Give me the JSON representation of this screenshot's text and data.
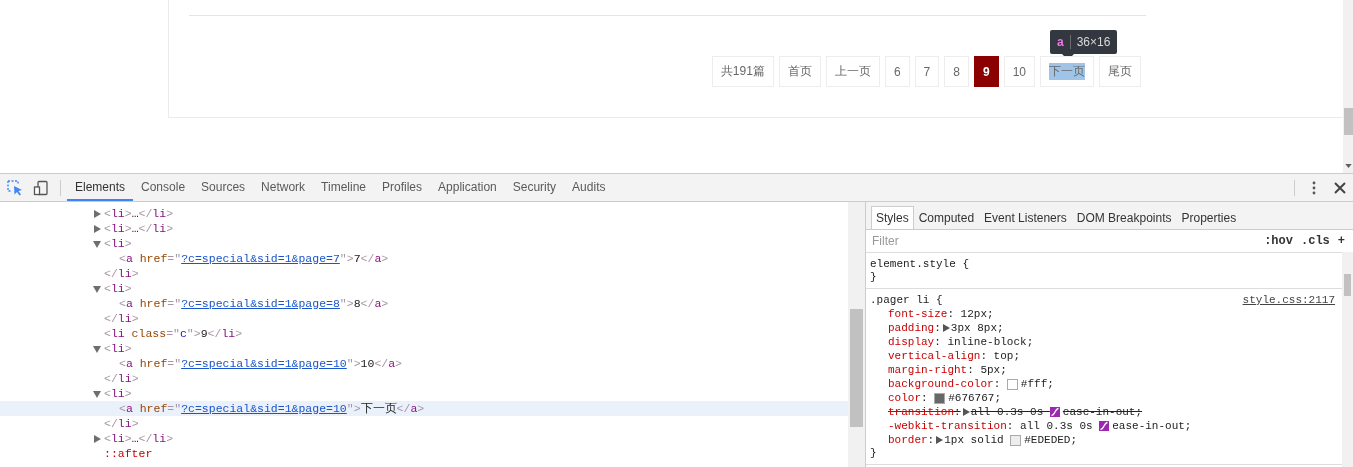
{
  "pager": {
    "items": [
      {
        "label": "共191篇",
        "selected": false,
        "inspected": false
      },
      {
        "label": "首页",
        "selected": false,
        "inspected": false
      },
      {
        "label": "上一页",
        "selected": false,
        "inspected": false
      },
      {
        "label": "6",
        "selected": false,
        "inspected": false
      },
      {
        "label": "7",
        "selected": false,
        "inspected": false
      },
      {
        "label": "8",
        "selected": false,
        "inspected": false
      },
      {
        "label": "9",
        "selected": true,
        "inspected": false
      },
      {
        "label": "10",
        "selected": false,
        "inspected": false
      },
      {
        "label": "下一页",
        "selected": false,
        "inspected": true
      },
      {
        "label": "尾页",
        "selected": false,
        "inspected": false
      }
    ],
    "tooltip": {
      "tag": "a",
      "size": "36×16"
    }
  },
  "devtools": {
    "tabs": [
      {
        "label": "Elements",
        "selected": true
      },
      {
        "label": "Console",
        "selected": false
      },
      {
        "label": "Sources",
        "selected": false
      },
      {
        "label": "Network",
        "selected": false
      },
      {
        "label": "Timeline",
        "selected": false
      },
      {
        "label": "Profiles",
        "selected": false
      },
      {
        "label": "Application",
        "selected": false
      },
      {
        "label": "Security",
        "selected": false
      },
      {
        "label": "Audits",
        "selected": false
      }
    ],
    "dom_nodes": [
      {
        "open": [
          {
            "kind": "bracket",
            "text": "<"
          },
          {
            "kind": "tag",
            "text": "li"
          },
          {
            "kind": "bracket",
            "text": ">"
          },
          {
            "kind": "text",
            "text": "…"
          },
          {
            "kind": "bracket",
            "text": "</"
          },
          {
            "kind": "tag",
            "text": "li"
          },
          {
            "kind": "bracket",
            "text": ">"
          }
        ],
        "expanded": false,
        "selected": false
      },
      {
        "open": [
          {
            "kind": "bracket",
            "text": "<"
          },
          {
            "kind": "tag",
            "text": "li"
          },
          {
            "kind": "bracket",
            "text": ">"
          },
          {
            "kind": "text",
            "text": "…"
          },
          {
            "kind": "bracket",
            "text": "</"
          },
          {
            "kind": "tag",
            "text": "li"
          },
          {
            "kind": "bracket",
            "text": ">"
          }
        ],
        "expanded": false,
        "selected": false
      },
      {
        "open": [
          {
            "kind": "bracket",
            "text": "<"
          },
          {
            "kind": "tag",
            "text": "li"
          },
          {
            "kind": "bracket",
            "text": ">"
          }
        ],
        "expanded": true,
        "selected": false,
        "close": [
          {
            "kind": "bracket",
            "text": "</"
          },
          {
            "kind": "tag",
            "text": "li"
          },
          {
            "kind": "bracket",
            "text": ">"
          }
        ],
        "children": [
          {
            "open": [
              {
                "kind": "bracket",
                "text": "<"
              },
              {
                "kind": "tag",
                "text": "a"
              },
              {
                "kind": "attr",
                "text": "href"
              },
              {
                "kind": "bracket",
                "text": "=\""
              },
              {
                "kind": "link",
                "text": "?c=special&sid=1&page=7"
              },
              {
                "kind": "bracket",
                "text": "\">"
              },
              {
                "kind": "text",
                "text": "7"
              },
              {
                "kind": "bracket",
                "text": "</"
              },
              {
                "kind": "tag",
                "text": "a"
              },
              {
                "kind": "bracket",
                "text": ">"
              }
            ],
            "selected": false
          }
        ]
      },
      {
        "open": [
          {
            "kind": "bracket",
            "text": "<"
          },
          {
            "kind": "tag",
            "text": "li"
          },
          {
            "kind": "bracket",
            "text": ">"
          }
        ],
        "expanded": true,
        "selected": false,
        "close": [
          {
            "kind": "bracket",
            "text": "</"
          },
          {
            "kind": "tag",
            "text": "li"
          },
          {
            "kind": "bracket",
            "text": ">"
          }
        ],
        "children": [
          {
            "open": [
              {
                "kind": "bracket",
                "text": "<"
              },
              {
                "kind": "tag",
                "text": "a"
              },
              {
                "kind": "attr",
                "text": "href"
              },
              {
                "kind": "bracket",
                "text": "=\""
              },
              {
                "kind": "link",
                "text": "?c=special&sid=1&page=8"
              },
              {
                "kind": "bracket",
                "text": "\">"
              },
              {
                "kind": "text",
                "text": "8"
              },
              {
                "kind": "bracket",
                "text": "</"
              },
              {
                "kind": "tag",
                "text": "a"
              },
              {
                "kind": "bracket",
                "text": ">"
              }
            ],
            "selected": false
          }
        ]
      },
      {
        "open": [
          {
            "kind": "bracket",
            "text": "<"
          },
          {
            "kind": "tag",
            "text": "li"
          },
          {
            "kind": "attr",
            "text": "class"
          },
          {
            "kind": "bracket",
            "text": "=\""
          },
          {
            "kind": "value",
            "text": "c"
          },
          {
            "kind": "bracket",
            "text": "\">"
          },
          {
            "kind": "text",
            "text": "9"
          },
          {
            "kind": "bracket",
            "text": "</"
          },
          {
            "kind": "tag",
            "text": "li"
          },
          {
            "kind": "bracket",
            "text": ">"
          }
        ],
        "selected": false
      },
      {
        "open": [
          {
            "kind": "bracket",
            "text": "<"
          },
          {
            "kind": "tag",
            "text": "li"
          },
          {
            "kind": "bracket",
            "text": ">"
          }
        ],
        "expanded": true,
        "selected": false,
        "close": [
          {
            "kind": "bracket",
            "text": "</"
          },
          {
            "kind": "tag",
            "text": "li"
          },
          {
            "kind": "bracket",
            "text": ">"
          }
        ],
        "children": [
          {
            "open": [
              {
                "kind": "bracket",
                "text": "<"
              },
              {
                "kind": "tag",
                "text": "a"
              },
              {
                "kind": "attr",
                "text": "href"
              },
              {
                "kind": "bracket",
                "text": "=\""
              },
              {
                "kind": "link",
                "text": "?c=special&sid=1&page=10"
              },
              {
                "kind": "bracket",
                "text": "\">"
              },
              {
                "kind": "text",
                "text": "10"
              },
              {
                "kind": "bracket",
                "text": "</"
              },
              {
                "kind": "tag",
                "text": "a"
              },
              {
                "kind": "bracket",
                "text": ">"
              }
            ],
            "selected": false
          }
        ]
      },
      {
        "open": [
          {
            "kind": "bracket",
            "text": "<"
          },
          {
            "kind": "tag",
            "text": "li"
          },
          {
            "kind": "bracket",
            "text": ">"
          }
        ],
        "expanded": true,
        "selected": false,
        "close": [
          {
            "kind": "bracket",
            "text": "</"
          },
          {
            "kind": "tag",
            "text": "li"
          },
          {
            "kind": "bracket",
            "text": ">"
          }
        ],
        "children": [
          {
            "open": [
              {
                "kind": "bracket",
                "text": "<"
              },
              {
                "kind": "tag",
                "text": "a"
              },
              {
                "kind": "attr",
                "text": "href"
              },
              {
                "kind": "bracket",
                "text": "=\""
              },
              {
                "kind": "link",
                "text": "?c=special&sid=1&page=10"
              },
              {
                "kind": "bracket",
                "text": "\">"
              },
              {
                "kind": "text",
                "text": "下一页"
              },
              {
                "kind": "bracket",
                "text": "</"
              },
              {
                "kind": "tag",
                "text": "a"
              },
              {
                "kind": "bracket",
                "text": ">"
              }
            ],
            "selected": true
          }
        ]
      },
      {
        "open": [
          {
            "kind": "bracket",
            "text": "<"
          },
          {
            "kind": "tag",
            "text": "li"
          },
          {
            "kind": "bracket",
            "text": ">"
          },
          {
            "kind": "text",
            "text": "…"
          },
          {
            "kind": "bracket",
            "text": "</"
          },
          {
            "kind": "tag",
            "text": "li"
          },
          {
            "kind": "bracket",
            "text": ">"
          }
        ],
        "expanded": false,
        "selected": false
      },
      {
        "open": [
          {
            "kind": "pseudo",
            "text": "::after"
          }
        ],
        "selected": false
      }
    ],
    "sidebar_tabs": [
      {
        "label": "Styles",
        "selected": true
      },
      {
        "label": "Computed",
        "selected": false
      },
      {
        "label": "Event Listeners",
        "selected": false
      },
      {
        "label": "DOM Breakpoints",
        "selected": false
      },
      {
        "label": "Properties",
        "selected": false
      }
    ],
    "filter": {
      "placeholder": "Filter"
    },
    "filter_buttons": [
      ":hov",
      ".cls",
      "+"
    ],
    "rules": [
      {
        "selector": "element.style",
        "open": " {",
        "close": "}"
      },
      {
        "selector": ".pager li",
        "open": " {",
        "close": "}",
        "source": "style.css:2117",
        "declarations": [
          {
            "name": "font-size",
            "overridden": false,
            "value": [
              {
                "kind": "text",
                "text": ": 12px;"
              }
            ]
          },
          {
            "name": "padding",
            "overridden": false,
            "value": [
              {
                "kind": "text",
                "text": ":"
              },
              {
                "kind": "expander"
              },
              {
                "kind": "text",
                "text": "3px 8px;"
              }
            ]
          },
          {
            "name": "display",
            "overridden": false,
            "value": [
              {
                "kind": "text",
                "text": ": inline-block;"
              }
            ]
          },
          {
            "name": "vertical-align",
            "overridden": false,
            "value": [
              {
                "kind": "text",
                "text": ": top;"
              }
            ]
          },
          {
            "name": "margin-right",
            "overridden": false,
            "value": [
              {
                "kind": "text",
                "text": ": 5px;"
              }
            ]
          },
          {
            "name": "background-color",
            "overridden": false,
            "value": [
              {
                "kind": "text",
                "text": ": "
              },
              {
                "kind": "swatch",
                "color": "#ffffff"
              },
              {
                "kind": "text",
                "text": "#fff;"
              }
            ]
          },
          {
            "name": "color",
            "overridden": false,
            "value": [
              {
                "kind": "text",
                "text": ": "
              },
              {
                "kind": "swatch",
                "color": "#676767"
              },
              {
                "kind": "text",
                "text": "#676767;"
              }
            ]
          },
          {
            "name": "transition",
            "overridden": true,
            "value": [
              {
                "kind": "text",
                "text": ":"
              },
              {
                "kind": "expander"
              },
              {
                "kind": "text",
                "text": "all 0.3s 0s "
              },
              {
                "kind": "easing"
              },
              {
                "kind": "text",
                "text": "ease-in-out;"
              }
            ]
          },
          {
            "name": "-webkit-transition",
            "overridden": false,
            "value": [
              {
                "kind": "text",
                "text": ": all 0.3s 0s "
              },
              {
                "kind": "easing"
              },
              {
                "kind": "text",
                "text": "ease-in-out;"
              }
            ]
          },
          {
            "name": "border",
            "overridden": false,
            "value": [
              {
                "kind": "text",
                "text": ":"
              },
              {
                "kind": "expander"
              },
              {
                "kind": "text",
                "text": "1px solid "
              },
              {
                "kind": "swatch",
                "color": "#ededed"
              },
              {
                "kind": "text",
                "text": "#EDEDED;"
              }
            ]
          }
        ]
      }
    ]
  }
}
